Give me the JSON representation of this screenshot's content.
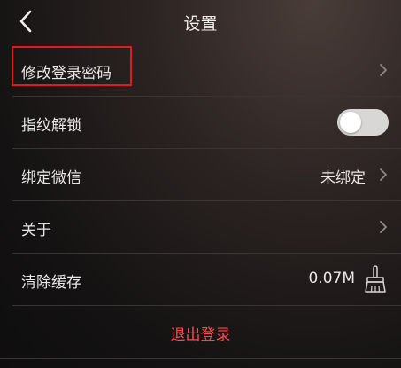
{
  "header": {
    "title": "设置"
  },
  "rows": [
    {
      "label": "修改登录密码"
    },
    {
      "label": "指纹解锁",
      "toggle_on": false
    },
    {
      "label": "绑定微信",
      "value": "未绑定"
    },
    {
      "label": "关于"
    },
    {
      "label": "清除缓存",
      "value": "0.07M"
    }
  ],
  "logout_label": "退出登录",
  "colors": {
    "highlight": "#e01b1b",
    "logout": "#ff4a4a",
    "toggle_track": "#d9d7d6"
  },
  "icons": {
    "back": "chevron-left-icon",
    "row_arrow": "chevron-right-icon",
    "clear_cache": "broom-icon"
  }
}
